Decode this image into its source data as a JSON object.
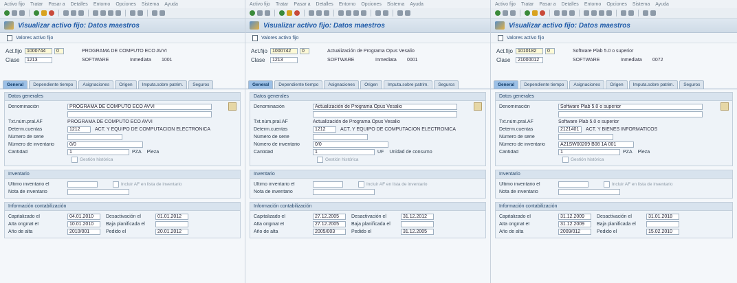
{
  "menu": [
    "Activo fijo",
    "Tratar",
    "Pasar a",
    "Detalles",
    "Entorno",
    "Opciones",
    "Sistema",
    "Ayuda"
  ],
  "title": "Visualizar activo fijo: Datos maestros",
  "app_button": "Valores activo fijo",
  "labels": {
    "act_fijo": "Act.fijo",
    "clase": "Clase",
    "datos_generales": "Datos generales",
    "denominacion": "Denominación",
    "txt_num_pral": "Txt.núm.pral.AF",
    "determ_cuentas": "Determ.cuentas",
    "numero_serie": "Número de serie",
    "numero_inventario": "Número de inventario",
    "cantidad": "Cantidad",
    "inventario": "Inventario",
    "ultimo_inventario": "Último inventario el",
    "nota_inventario": "Nota de inventario",
    "info_contab": "Información contabilización",
    "capitalizado": "Capitalizado el",
    "alta_original": "Alta original el",
    "ano_alta": "Año de alta",
    "desactivacion": "Desactivación el",
    "baja_planificada": "Baja planificada el",
    "pedido": "Pedido el"
  },
  "tabs": [
    "General",
    "Dependiente tiempo",
    "Asignaciones",
    "Origen",
    "Imputa.sobre patrim.",
    "Seguros"
  ],
  "panels": [
    {
      "asset": "1000744",
      "sub": "0",
      "asset_desc": "PROGRAMA DE COMPUTO ECO AVVI",
      "class": "1213",
      "class_desc": "SOFTWARE",
      "class_extra": "Inmediata",
      "class_num": "1001",
      "denominacion": "PROGRAMA DE COMPUTO ECO AVVI",
      "txt_num": "PROGRAMA DE COMPUTO ECO AVVI",
      "determ": "1212",
      "determ_desc": "ACT. Y EQUIPO DE COMPUTACION ELECTRONICA",
      "serie": "",
      "inventario_num": "0/0",
      "cantidad": "1",
      "unidad": "PZA",
      "unidad_desc": "Pieza",
      "cbox_text": "Gestión histórica",
      "ultimo_inv": "",
      "inv_cbox_text": "Incluir AF en lista de inventario",
      "nota_inv": "",
      "capitalizado": "04.01.2010",
      "alta_original": "10.01.2010",
      "ano_alta": "2010/001",
      "desactivacion": "01.01.2012",
      "baja_plan": "",
      "pedido": "20.01.2012"
    },
    {
      "asset": "1000742",
      "sub": "0",
      "asset_desc": "Actualización de Programa Opus Vesalio",
      "class": "1213",
      "class_desc": "SOFTWARE",
      "class_extra": "Inmediata",
      "class_num": "0001",
      "denominacion": "Actualización de Programa Opus Vesalio",
      "txt_num": "Actualización de Programa Opus Vesalio",
      "determ": "1212",
      "determ_desc": "ACT. Y EQUIPO DE COMPUTACION ELECTRONICA",
      "serie": "",
      "inventario_num": "0/0",
      "cantidad": "1",
      "unidad": "UF",
      "unidad_desc": "Unidad de consumo",
      "cbox_text": "Gestión histórica",
      "ultimo_inv": "",
      "inv_cbox_text": "Incluir AF en lista de inventario",
      "nota_inv": "",
      "capitalizado": "27.12.2005",
      "alta_original": "27.12.2005",
      "ano_alta": "2005/003",
      "desactivacion": "31.12.2012",
      "baja_plan": "",
      "pedido": "31.12.2005"
    },
    {
      "asset": "1010182",
      "sub": "0",
      "asset_desc": "Software Plab 5.0 o superior",
      "class": "21000012",
      "class_desc": "SOFTWARE",
      "class_extra": "Inmediata",
      "class_num": "0072",
      "denominacion": "Software Plab 5.0 o superior",
      "txt_num": "Software Plab 5.0 o superior",
      "determ": "2121401",
      "determ_desc": "ACT. Y BIENES INFORMATICOS",
      "serie": "",
      "inventario_num": "A21SW00209 B08 1A 001",
      "cantidad": "1",
      "unidad": "PZA",
      "unidad_desc": "Pieza",
      "cbox_text": "Gestión histórica",
      "ultimo_inv": "",
      "inv_cbox_text": "Incluir AF en lista de inventario",
      "nota_inv": "",
      "capitalizado": "31.12.2009",
      "alta_original": "31.12.2009",
      "ano_alta": "2009/012",
      "desactivacion": "31.01.2018",
      "baja_plan": "",
      "pedido": "15.02.2010"
    }
  ]
}
